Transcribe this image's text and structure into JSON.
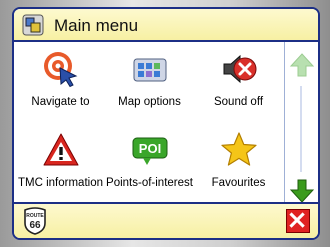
{
  "window": {
    "title": "Main menu",
    "title_icon": "main-menu-icon"
  },
  "menu": {
    "items": [
      {
        "label": "Navigate to",
        "icon": "target-cursor-icon"
      },
      {
        "label": "Map options",
        "icon": "map-options-icon"
      },
      {
        "label": "Sound off",
        "icon": "sound-off-icon"
      },
      {
        "label": "TMC information",
        "icon": "warning-triangle-icon"
      },
      {
        "label": "Points-of-interest",
        "icon": "poi-icon"
      },
      {
        "label": "Favourites",
        "icon": "star-icon"
      }
    ]
  },
  "scrollbar": {
    "up_icon": "arrow-up-icon",
    "down_icon": "arrow-down-icon"
  },
  "bottom": {
    "route_badge": {
      "icon": "route-66-icon",
      "text_top": "ROUTE",
      "text_num": "66"
    },
    "close_icon": "close-icon"
  },
  "colors": {
    "frame": "#1c2f86",
    "bar": "#f7f0a3",
    "close": "#e02222",
    "arrow_active": "#3a9b1c",
    "arrow_disabled": "#b8e0b0"
  }
}
